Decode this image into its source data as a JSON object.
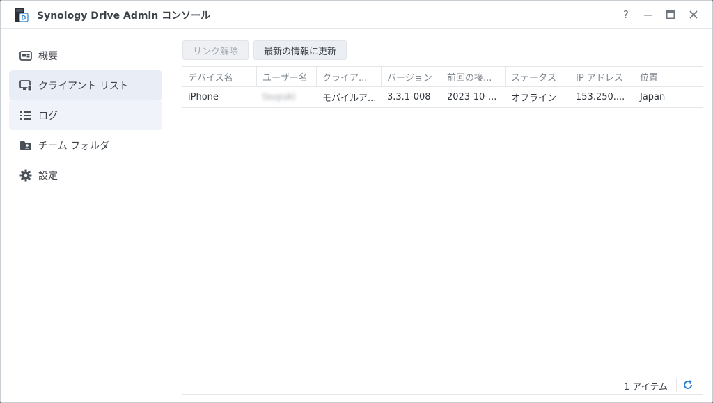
{
  "window": {
    "title": "Synology Drive Admin コンソール",
    "help_label": "?"
  },
  "colors": {
    "accent": "#2e82d6",
    "sidebar_active": "#e9eef6",
    "sidebar_hover": "#f0f4fa"
  },
  "sidebar": {
    "items": [
      {
        "label": "概要",
        "icon": "overview-card-icon"
      },
      {
        "label": "クライアント リスト",
        "icon": "client-monitor-icon"
      },
      {
        "label": "ログ",
        "icon": "list-log-icon"
      },
      {
        "label": "チーム フォルダ",
        "icon": "team-folder-icon"
      },
      {
        "label": "設定",
        "icon": "gear-icon"
      }
    ]
  },
  "toolbar": {
    "unlink_label": "リンク解除",
    "refresh_info_label": "最新の情報に更新"
  },
  "table": {
    "columns": [
      "デバイス名",
      "ユーザー名",
      "クライア...",
      "バージョン",
      "前回の接...",
      "ステータス",
      "IP アドレス",
      "位置"
    ],
    "rows": [
      [
        "iPhone",
        "tsuyuki",
        "モバイルア...",
        "3.3.1-008",
        "2023-10-...",
        "オフライン",
        "153.250....",
        "Japan"
      ]
    ]
  },
  "footer": {
    "item_count": "1 アイテム"
  }
}
